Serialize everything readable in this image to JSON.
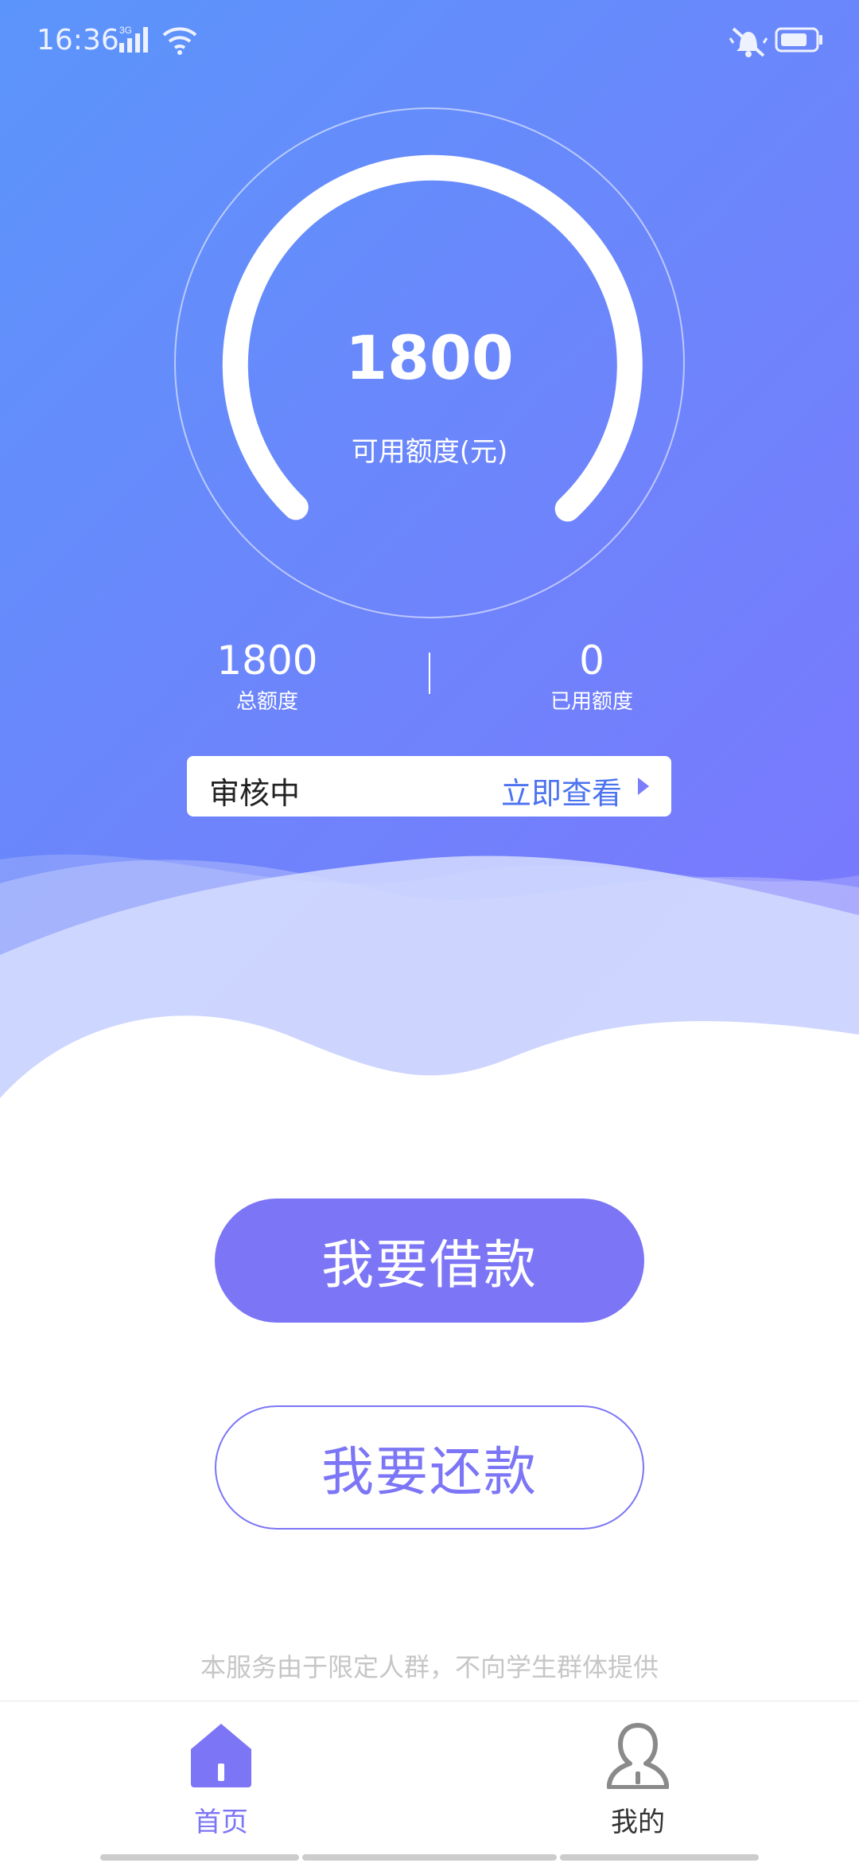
{
  "status_bar": {
    "time": "16:36",
    "network": "3G",
    "icons": [
      "signal-icon",
      "wifi-icon",
      "vibrate-mute-icon",
      "battery-icon"
    ]
  },
  "credit": {
    "available_amount": "1800",
    "available_label": "可用额度(元)",
    "total_amount": "1800",
    "total_label": "总额度",
    "used_amount": "0",
    "used_label": "已用额度"
  },
  "review": {
    "status": "审核中",
    "link_label": "立即查看"
  },
  "actions": {
    "borrow_label": "我要借款",
    "repay_label": "我要还款"
  },
  "disclaimer": "本服务由于限定人群，不向学生群体提供",
  "tabs": [
    {
      "label": "首页",
      "icon": "home-icon",
      "active": true
    },
    {
      "label": "我的",
      "icon": "person-icon",
      "active": false
    }
  ],
  "colors": {
    "accent": "#7c75f6",
    "gradient_start": "#5b95fb",
    "gradient_end": "#7d76fe",
    "link": "#4c73f0"
  }
}
